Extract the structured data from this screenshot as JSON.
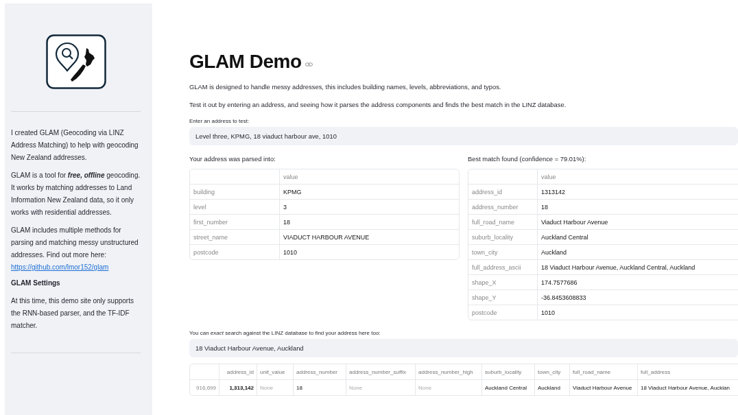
{
  "sidebar": {
    "paragraphs": [
      {
        "text": "I created GLAM (Geocoding via LINZ Address Matching) to help with geocoding New Zealand addresses."
      },
      {
        "text": "GLAM is a tool for **free, offline** geocoding. It works by matching addresses to Land Information New Zealand data, so it only works with residential addresses."
      },
      {
        "text": "GLAM includes multiple methods for parsing and matching messy unstructured addresses. Find out more here:",
        "link": "https://github.com/lmor152/glam"
      }
    ],
    "settings_heading": "GLAM Settings",
    "settings_text": "At this time, this demo site only supports the RNN-based parser, and the TF-IDF matcher."
  },
  "title": "GLAM Demo",
  "intro": [
    "GLAM is designed to handle messy addresses, this includes building names, levels, abbreviations, and typos.",
    "Test it out by entering an address, and seeing how it parses the address components and finds the best match in the LINZ database."
  ],
  "address_input": {
    "label": "Enter an address to test:",
    "value": "Level three, KPMG, 18 viaduct harbour ave, 1010"
  },
  "parsed": {
    "caption": "Your address was parsed into:",
    "column": "value",
    "rows": [
      {
        "key": "building",
        "value": "KPMG"
      },
      {
        "key": "level",
        "value": "3"
      },
      {
        "key": "first_number",
        "value": "18"
      },
      {
        "key": "street_name",
        "value": "VIADUCT HARBOUR AVENUE"
      },
      {
        "key": "postcode",
        "value": "1010"
      }
    ]
  },
  "best_match": {
    "caption": "Best match found (confidence = 79.01%):",
    "column": "value",
    "rows": [
      {
        "key": "address_id",
        "value": "1313142"
      },
      {
        "key": "address_number",
        "value": "18"
      },
      {
        "key": "full_road_name",
        "value": "Viaduct Harbour Avenue"
      },
      {
        "key": "suburb_locality",
        "value": "Auckland Central"
      },
      {
        "key": "town_city",
        "value": "Auckland"
      },
      {
        "key": "full_address_ascii",
        "value": "18 Viaduct Harbour Avenue, Auckland Central, Auckland"
      },
      {
        "key": "shape_X",
        "value": "174.7577686"
      },
      {
        "key": "shape_Y",
        "value": "-36.8453608833"
      },
      {
        "key": "postcode",
        "value": "1010"
      }
    ]
  },
  "search_input": {
    "label": "You can *exact* search against the LINZ database to find your address here too:",
    "value": "18 Viaduct Harbour Avenue, Auckland"
  },
  "results": {
    "columns": [
      "address_id",
      "unit_value",
      "address_number",
      "address_number_suffix",
      "address_number_high",
      "suburb_locality",
      "town_city",
      "full_road_name",
      "full_address"
    ],
    "rows": [
      {
        "index": "916,699",
        "cells": [
          {
            "text": "1,313,142",
            "kind": "number"
          },
          {
            "text": "None",
            "kind": "null"
          },
          {
            "text": "18",
            "kind": "text"
          },
          {
            "text": "None",
            "kind": "null"
          },
          {
            "text": "None",
            "kind": "null"
          },
          {
            "text": "Auckland Central",
            "kind": "text"
          },
          {
            "text": "Auckland",
            "kind": "text"
          },
          {
            "text": "Viaduct Harbour Avenue",
            "kind": "text"
          },
          {
            "text": "18 Viaduct Harbour Avenue, Aucklan",
            "kind": "text"
          }
        ]
      }
    ]
  }
}
